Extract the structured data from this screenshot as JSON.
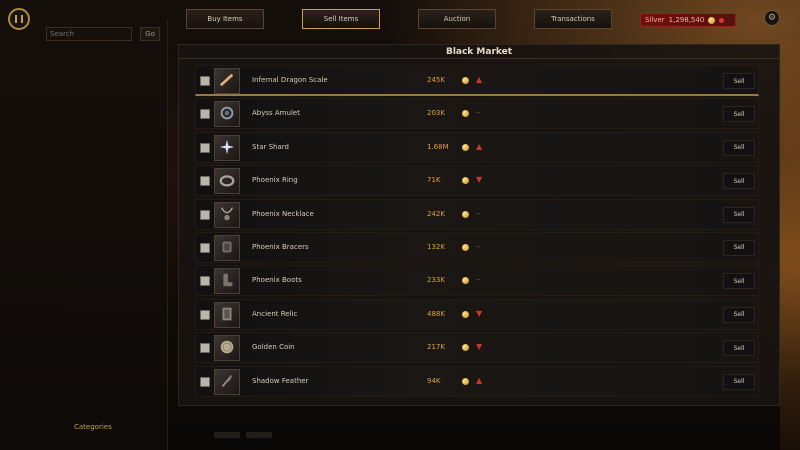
{
  "header": {
    "tabs": [
      {
        "label": "Buy Items"
      },
      {
        "label": "Sell Items"
      },
      {
        "label": "Auction"
      },
      {
        "label": "Transactions"
      }
    ],
    "currency": {
      "amount": "1,298,540",
      "unit": "Silver"
    }
  },
  "sidebar": {
    "search_placeholder": "Search",
    "search_button": "Go",
    "footer_label": "Categories"
  },
  "market": {
    "title": "Black Market",
    "rows": [
      {
        "name": "Infernal Dragon Scale",
        "price": "245K",
        "change": "▲",
        "trend": "up",
        "action": "Sell",
        "icon": "bone-icon"
      },
      {
        "name": "Abyss Amulet",
        "price": "203K",
        "change": "–",
        "trend": "neutral",
        "action": "Sell",
        "icon": "amulet-icon"
      },
      {
        "name": "Star Shard",
        "price": "1.68M",
        "change": "▲",
        "trend": "up",
        "action": "Sell",
        "icon": "sparkle-icon"
      },
      {
        "name": "Phoenix Ring",
        "price": "71K",
        "change": "▼",
        "trend": "down",
        "action": "Sell",
        "icon": "ring-icon"
      },
      {
        "name": "Phoenix Necklace",
        "price": "242K",
        "change": "–",
        "trend": "neutral",
        "action": "Sell",
        "icon": "necklace-icon"
      },
      {
        "name": "Phoenix Bracers",
        "price": "132K",
        "change": "–",
        "trend": "neutral",
        "action": "Sell",
        "icon": "bracers-icon"
      },
      {
        "name": "Phoenix Boots",
        "price": "233K",
        "change": "–",
        "trend": "neutral",
        "action": "Sell",
        "icon": "boots-icon"
      },
      {
        "name": "Ancient Relic",
        "price": "488K",
        "change": "▼",
        "trend": "down",
        "action": "Sell",
        "icon": "relic-icon"
      },
      {
        "name": "Golden Coin",
        "price": "217K",
        "change": "▼",
        "trend": "down",
        "action": "Sell",
        "icon": "coin-icon"
      },
      {
        "name": "Shadow Feather",
        "price": "94K",
        "change": "▲",
        "trend": "up",
        "action": "Sell",
        "icon": "feather-icon"
      }
    ]
  },
  "colors": {
    "accent": "#c9a046",
    "price": "#e0a040",
    "change": "#c73a2a",
    "currency_bg": "#7a0a0a"
  }
}
